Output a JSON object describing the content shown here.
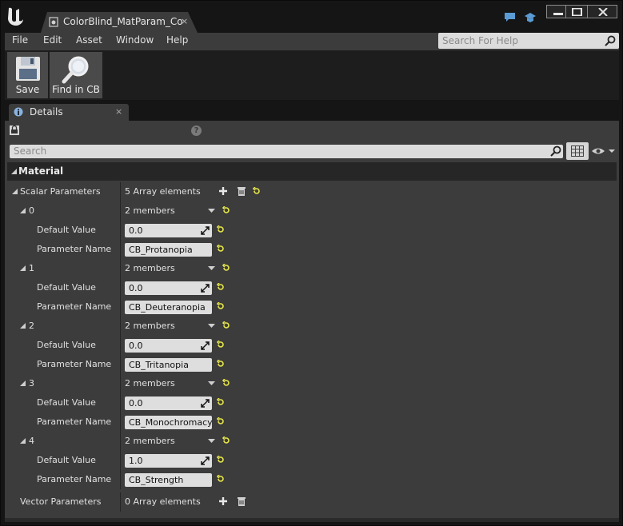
{
  "window": {
    "tab_title": "ColorBlind_MatParam_Col",
    "tab_close": "×",
    "minimize": "minimize",
    "maximize": "maximize",
    "close": "close"
  },
  "menu": [
    "File",
    "Edit",
    "Asset",
    "Window",
    "Help"
  ],
  "help_search": {
    "placeholder": "Search For Help"
  },
  "toolbar": {
    "save_label": "Save",
    "find_label": "Find in CB"
  },
  "details_tab": {
    "label": "Details",
    "close": "×"
  },
  "details_search": {
    "placeholder": "Search"
  },
  "category": {
    "label": "Material"
  },
  "scalar": {
    "label": "Scalar Parameters",
    "value": "5 Array elements"
  },
  "elements": [
    {
      "index": "0",
      "members": "2 members",
      "default_label": "Default Value",
      "default_value": "0.0",
      "name_label": "Parameter Name",
      "name_value": "CB_Protanopia"
    },
    {
      "index": "1",
      "members": "2 members",
      "default_label": "Default Value",
      "default_value": "0.0",
      "name_label": "Parameter Name",
      "name_value": "CB_Deuteranopia"
    },
    {
      "index": "2",
      "members": "2 members",
      "default_label": "Default Value",
      "default_value": "0.0",
      "name_label": "Parameter Name",
      "name_value": "CB_Tritanopia"
    },
    {
      "index": "3",
      "members": "2 members",
      "default_label": "Default Value",
      "default_value": "0.0",
      "name_label": "Parameter Name",
      "name_value": "CB_Monochromacy"
    },
    {
      "index": "4",
      "members": "2 members",
      "default_label": "Default Value",
      "default_value": "1.0",
      "name_label": "Parameter Name",
      "name_value": "CB_Strength"
    }
  ],
  "vector": {
    "label": "Vector Parameters",
    "value": "0 Array elements"
  },
  "colors": {
    "accent_reset": "#e8e84a",
    "panel": "#3c3c3c",
    "category": "#262626"
  }
}
